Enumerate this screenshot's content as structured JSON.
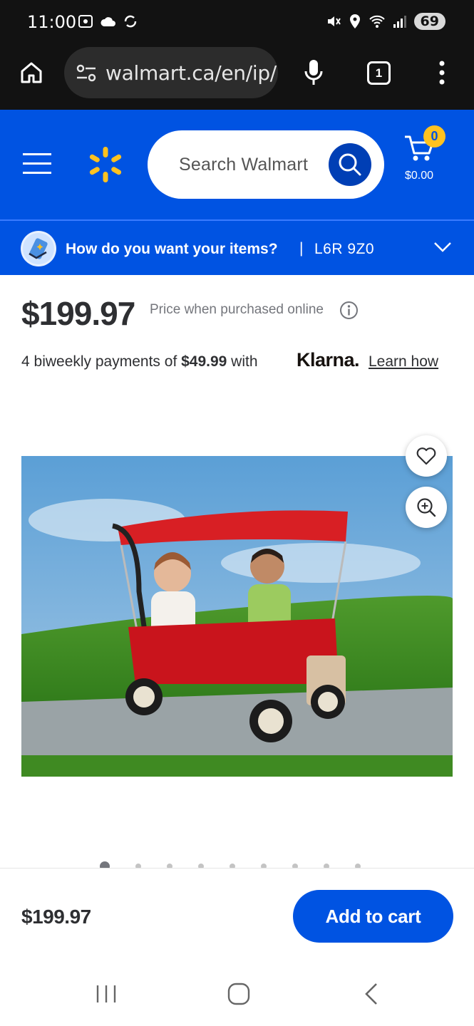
{
  "status_bar": {
    "time": "11:00",
    "battery": "69"
  },
  "browser": {
    "url": "walmart.ca/en/ip/",
    "tab_count": "1"
  },
  "header": {
    "search_placeholder": "Search Walmart",
    "cart_count": "0",
    "cart_total": "$0.00"
  },
  "delivery": {
    "question": "How do you want your items?",
    "separator": "|",
    "postal_code": "L6R 9Z0"
  },
  "product": {
    "price": "$199.97",
    "price_note": "Price when purchased online",
    "klarna_prefix": "4 biweekly payments of ",
    "klarna_amount": "$49.99",
    "klarna_with": " with",
    "klarna_brand": "Klarna.",
    "learn_how": "Learn how",
    "image_count": 9,
    "active_image": 1
  },
  "bottom_bar": {
    "price": "$199.97",
    "add_to_cart": "Add to cart"
  },
  "colors": {
    "walmart_blue": "#0053e2",
    "spark_yellow": "#ffc220",
    "dark_text": "#2e2f32"
  }
}
